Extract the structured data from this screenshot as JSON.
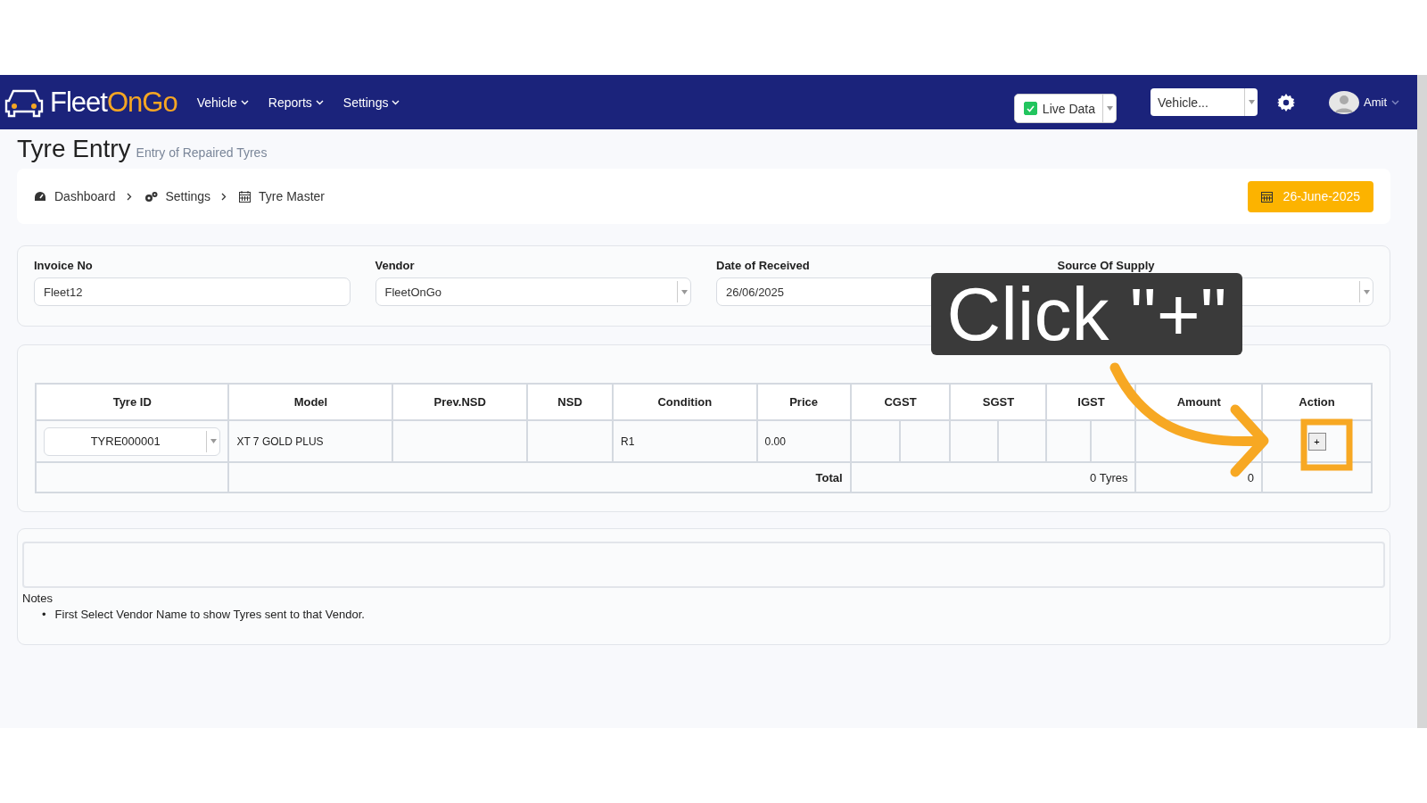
{
  "navbar": {
    "logo": [
      {
        "text": "Fleet",
        "color": "#ffffff"
      },
      {
        "text": "On",
        "color": "#f5a623"
      },
      {
        "text": "Go",
        "color": "#f5a623"
      }
    ],
    "menu": [
      {
        "label": "Vehicle"
      },
      {
        "label": "Reports"
      },
      {
        "label": "Settings"
      }
    ],
    "live_data": {
      "label": "Live Data",
      "checked": true
    },
    "vehicle_select": {
      "value": "Vehicle..."
    },
    "user": {
      "name": "Amit"
    }
  },
  "page": {
    "title": "Tyre Entry",
    "subtitle": "Entry of Repaired Tyres"
  },
  "breadcrumb": [
    {
      "label": "Dashboard",
      "kind": "dashboard"
    },
    {
      "label": "Settings",
      "kind": "settings"
    },
    {
      "label": "Tyre Master",
      "kind": "calendar"
    }
  ],
  "date_badge": "26-June-2025",
  "form": {
    "fields": [
      {
        "label": "Invoice No",
        "value": "Fleet12",
        "kind": "text"
      },
      {
        "label": "Vendor",
        "value": "FleetOnGo",
        "kind": "select"
      },
      {
        "label": "Date of Received",
        "value": "26/06/2025",
        "kind": "text"
      },
      {
        "label": "Source Of Supply",
        "kind": "select"
      }
    ]
  },
  "table": {
    "columns": [
      {
        "label": "Tyre ID",
        "kind": "single"
      },
      {
        "label": "Model",
        "kind": "single"
      },
      {
        "label": "Prev.NSD",
        "kind": "single"
      },
      {
        "label": "NSD",
        "kind": "single"
      },
      {
        "label": "Condition",
        "kind": "single"
      },
      {
        "label": "Price",
        "kind": "single"
      },
      {
        "label": "CGST",
        "kind": "split"
      },
      {
        "label": "SGST",
        "kind": "split"
      },
      {
        "label": "IGST",
        "kind": "split"
      },
      {
        "label": "Amount",
        "kind": "single"
      },
      {
        "label": "Action",
        "kind": "single"
      }
    ],
    "rows": [
      {
        "tyre_id": "TYRE000001",
        "model": "XT 7 GOLD PLUS",
        "condition": "R1",
        "price": "0.00",
        "action": "+"
      }
    ],
    "total": {
      "label": "Total",
      "count": "0 Tyres",
      "amount": "0"
    }
  },
  "notes": {
    "title": "Notes",
    "items": [
      {
        "marker": "•",
        "text": "First Select Vendor Name to show Tyres sent to that Vendor."
      }
    ]
  },
  "callout": {
    "text": "Click \"+\""
  }
}
